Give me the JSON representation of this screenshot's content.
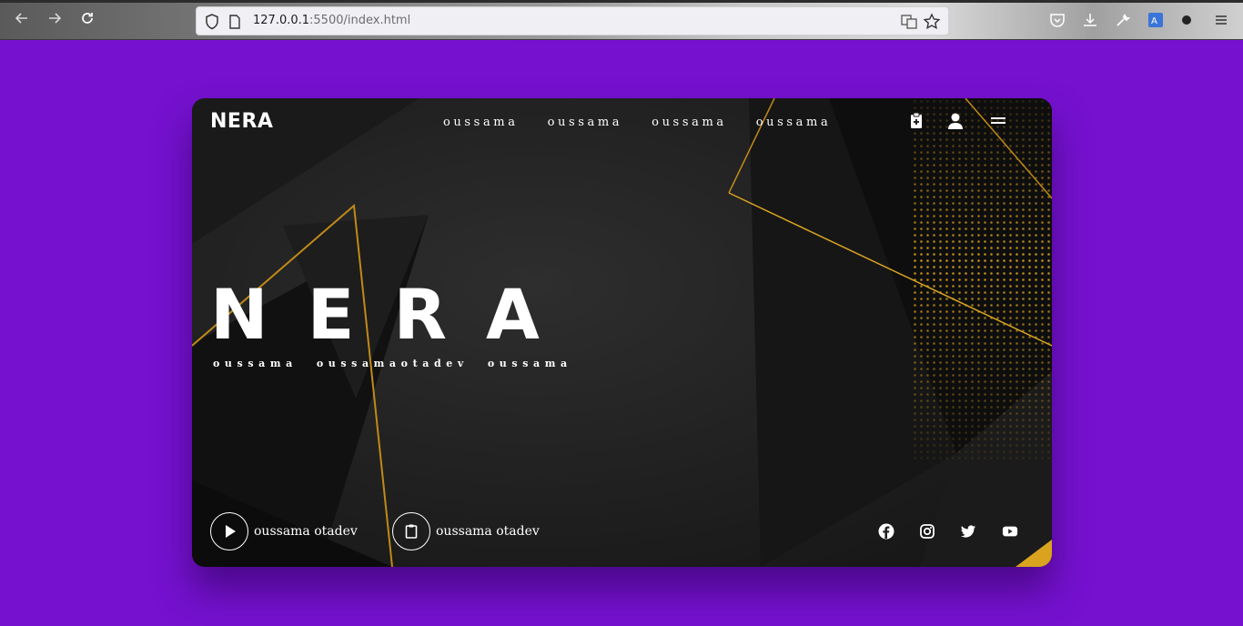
{
  "browser": {
    "url_host": "127.0.0.1",
    "url_rest": ":5500/index.html"
  },
  "hero": {
    "logo": "NERA",
    "nav": [
      "oussama",
      "oussama",
      "oussama",
      "oussama"
    ],
    "title": "NERA",
    "subtitle": [
      "oussama",
      "oussamaotadev",
      "oussama"
    ],
    "actions": [
      {
        "label": "oussama otadev",
        "icon": "play-icon"
      },
      {
        "label": "oussama otadev",
        "icon": "clipboard-icon"
      }
    ],
    "social": [
      "facebook-icon",
      "instagram-icon",
      "twitter-icon",
      "youtube-icon"
    ]
  },
  "colors": {
    "page_background": "#7511cf",
    "accent_gold": "#d9a320",
    "card_dark": "#222222"
  }
}
